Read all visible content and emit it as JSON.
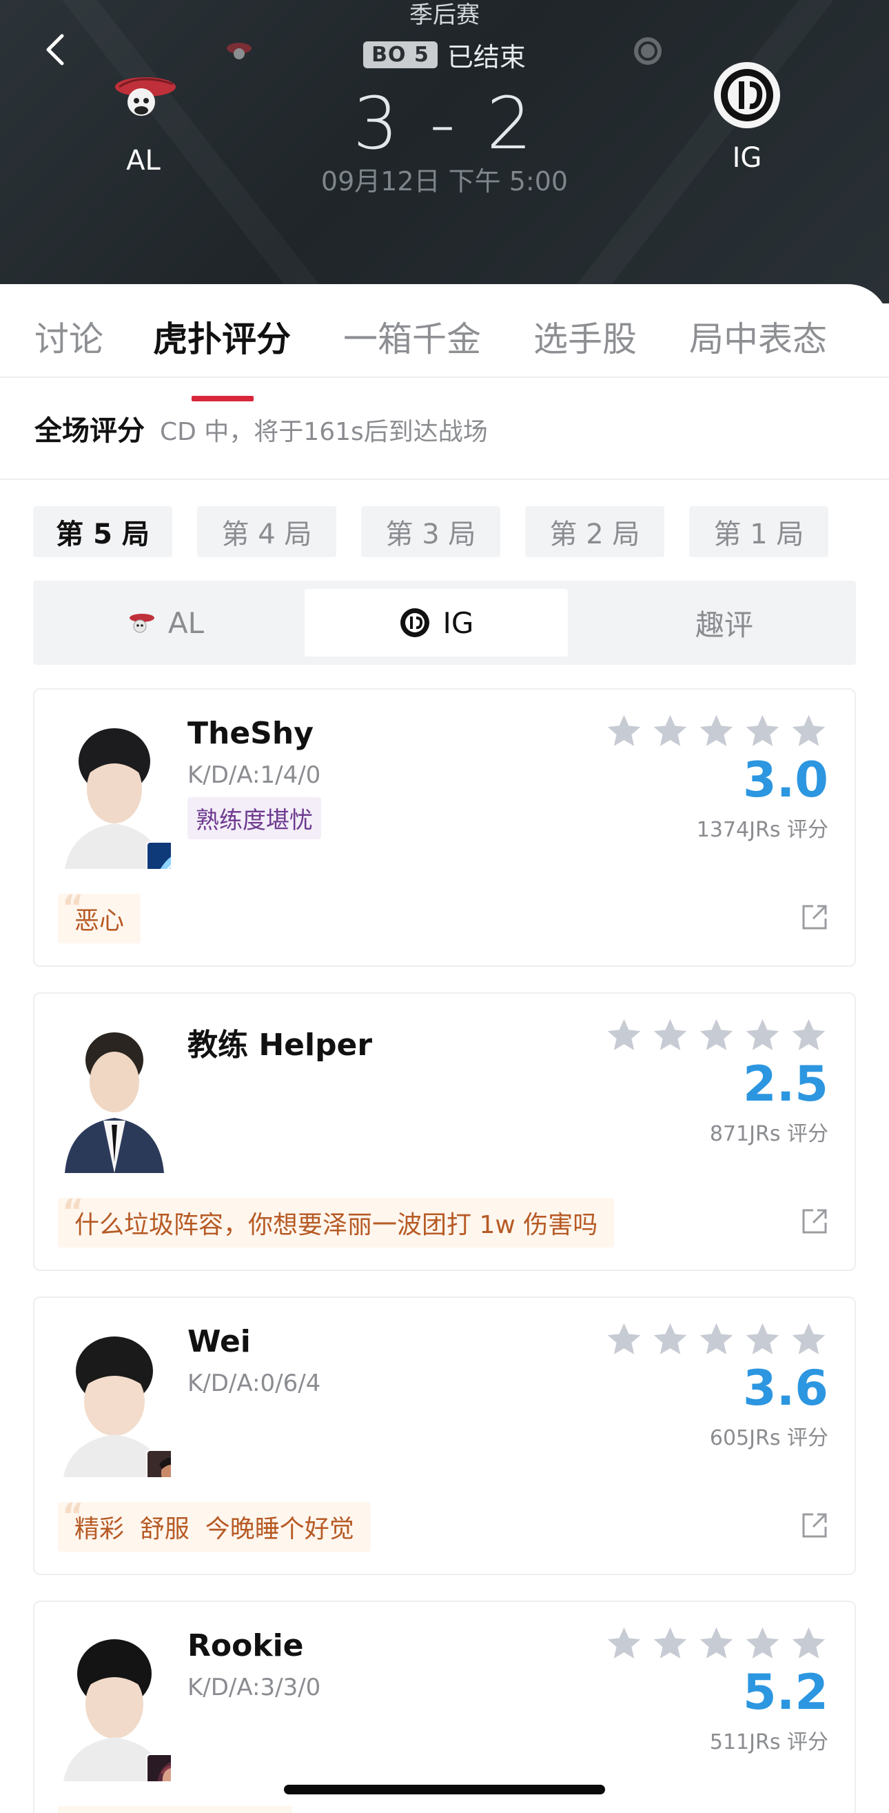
{
  "header": {
    "league": "季后赛",
    "bo_badge": "BO 5",
    "status": "已结束",
    "score": "3 - 2",
    "datetime": "09月12日 下午 5:00",
    "team_left": "AL",
    "team_right": "IG"
  },
  "tabs": [
    "讨论",
    "虎扑评分",
    "一箱千金",
    "选手股",
    "局中表态"
  ],
  "active_tab": "虎扑评分",
  "overall": {
    "title": "全场评分",
    "note": "CD 中，将于161s后到达战场"
  },
  "games": [
    "第 5 局",
    "第 4 局",
    "第 3 局",
    "第 2 局",
    "第 1 局"
  ],
  "active_game": "第 5 局",
  "team_segment": {
    "left": "AL",
    "middle": "IG",
    "right": "趣评",
    "active": "IG"
  },
  "colors": {
    "accent_red": "#d8263a",
    "rating_blue": "#2c96e0",
    "star_gray": "#c7cbd3",
    "quote_text": "#b65a24",
    "tag_purple": "#6e3a8f"
  },
  "players": [
    {
      "name": "TheShy",
      "kda": "K/D/A:1/4/0",
      "tag": "熟练度堪忧",
      "rating": "3.0",
      "jrs": "1374JRs 评分",
      "quote": "恶心",
      "champion_icon": "ice-bird-champion-icon"
    },
    {
      "name": "教练 Helper",
      "kda": "",
      "tag": "",
      "rating": "2.5",
      "jrs": "871JRs 评分",
      "quote": "什么垃圾阵容，你想要泽丽一波团打 1w 伤害吗",
      "champion_icon": ""
    },
    {
      "name": "Wei",
      "kda": "K/D/A:0/6/4",
      "tag": "",
      "rating": "3.6",
      "jrs": "605JRs 评分",
      "quote": "精彩  舒服  今晚睡个好觉",
      "champion_icon": "warrior-champion-icon"
    },
    {
      "name": "Rookie",
      "kda": "K/D/A:3/3/0",
      "tag": "",
      "rating": "5.2",
      "jrs": "511JRs 评分",
      "quote": "",
      "champion_icon": "mage-champion-icon"
    }
  ]
}
